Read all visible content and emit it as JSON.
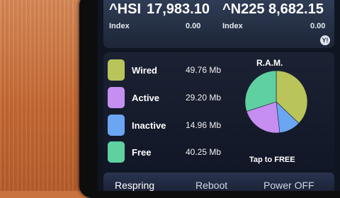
{
  "stocks": {
    "quotes": [
      {
        "symbol": "^HSI",
        "value": "17,983.10",
        "type": "Index",
        "change": "0.00"
      },
      {
        "symbol": "^N225",
        "value": "8,682.15",
        "type": "Index",
        "change": "0.00"
      }
    ],
    "badge": "Y!"
  },
  "ram": {
    "title": "R.A.M.",
    "rows": [
      {
        "label": "Wired",
        "amount": "49.76 Mb",
        "color": "#b9c45a"
      },
      {
        "label": "Active",
        "amount": "29.20 Mb",
        "color": "#c58ef0"
      },
      {
        "label": "Inactive",
        "amount": "14.96 Mb",
        "color": "#6aa6f2"
      },
      {
        "label": "Free",
        "amount": "40.25 Mb",
        "color": "#5fd0a0"
      }
    ],
    "tap_label": "Tap to FREE"
  },
  "buttons": {
    "respring": "Respring",
    "reboot": "Reboot",
    "power_off": "Power OFF"
  }
}
